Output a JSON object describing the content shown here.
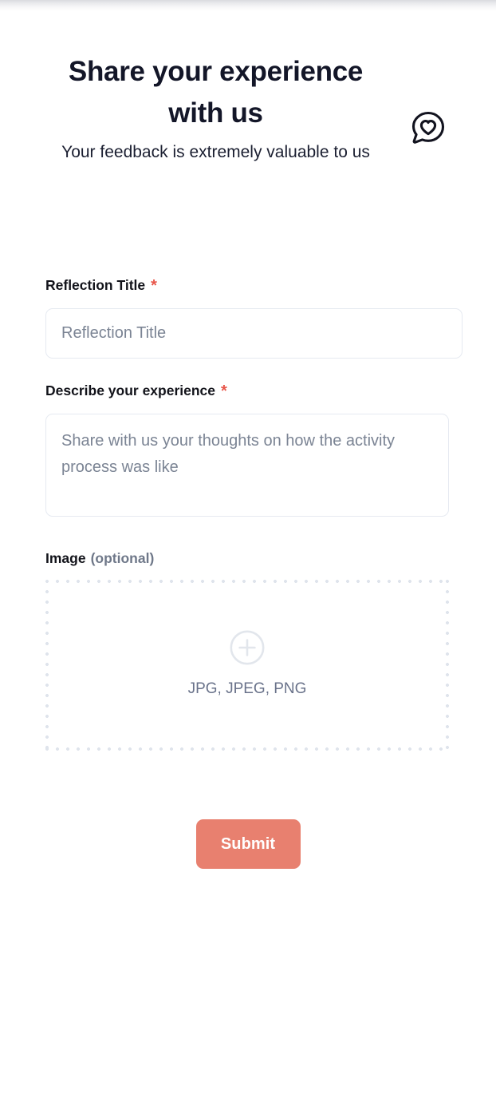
{
  "header": {
    "title": "Share your experience with us",
    "subtitle": "Your feedback is extremely valuable to us",
    "icon": "message-heart-icon"
  },
  "form": {
    "fields": [
      {
        "label": "Reflection Title",
        "required_marker": "*",
        "type": "text",
        "value": "",
        "placeholder": "Reflection Title"
      },
      {
        "label": "Describe your experience",
        "required_marker": "*",
        "type": "textarea",
        "value": "",
        "placeholder": "Share with us your thoughts on how the activity process was like"
      }
    ],
    "image_upload": {
      "label": "Image",
      "optional_label": "(optional)",
      "add_icon": "circle-plus-icon",
      "accepted_formats": "JPG, JPEG, PNG"
    },
    "submit_label": "Submit"
  },
  "colors": {
    "accent_button": "#e8806f",
    "required_star": "#e8574b",
    "heading_text": "#131628",
    "placeholder_text": "#7b8494",
    "field_border": "#e6eaf1",
    "dropzone_dots": "#dfe4ec",
    "dropzone_icon": "#e2e6ec",
    "muted_text": "#69728a"
  }
}
